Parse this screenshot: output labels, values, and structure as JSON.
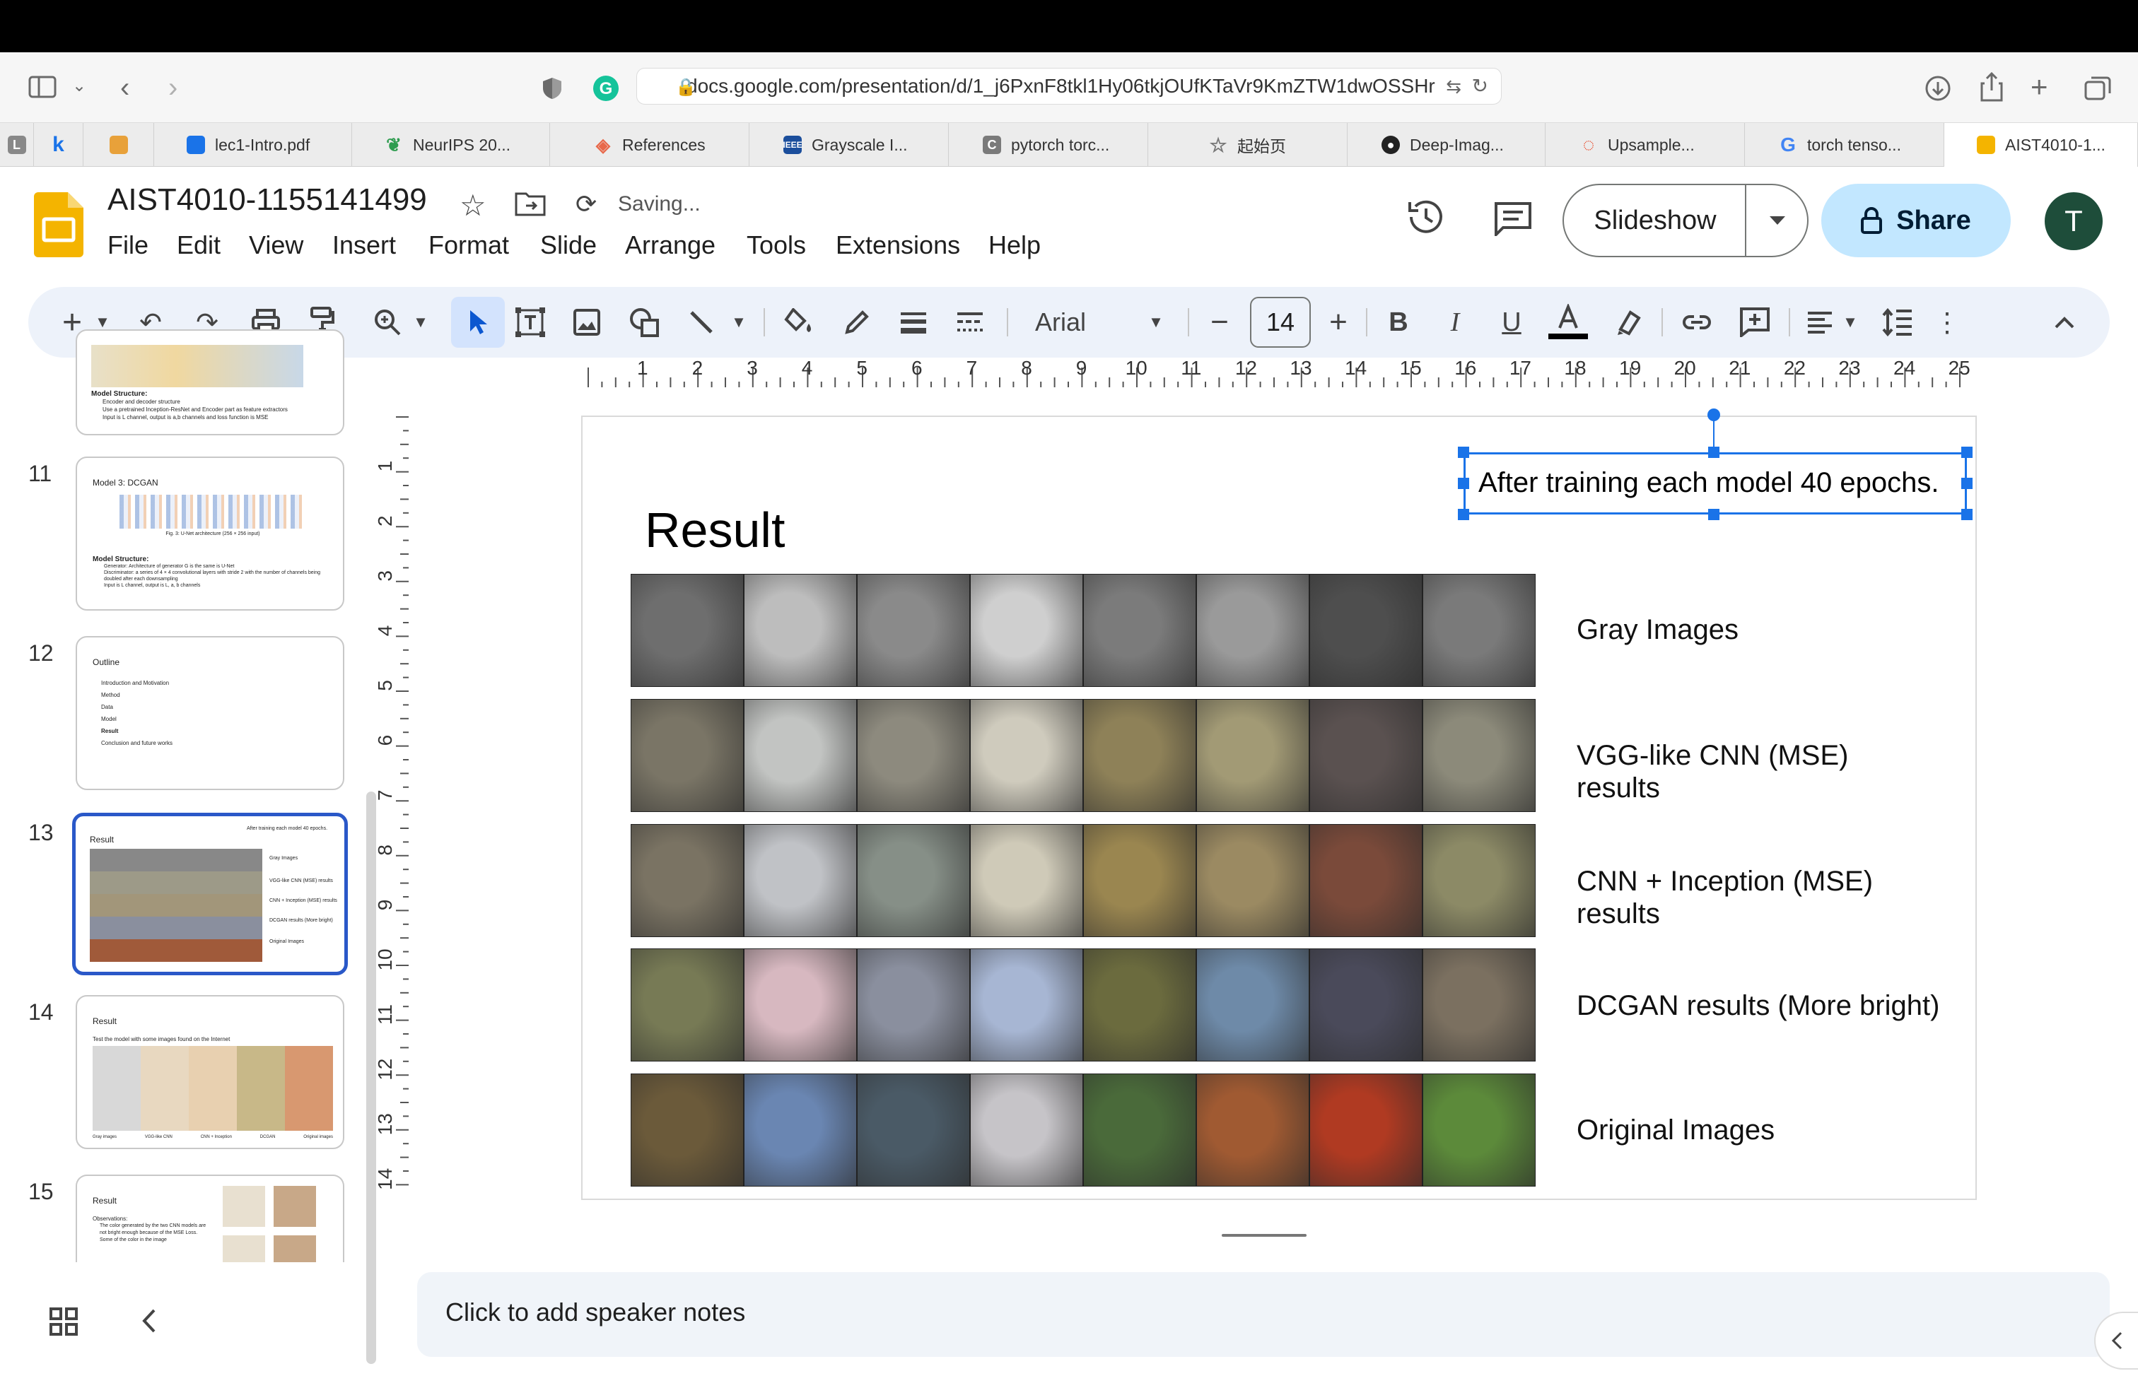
{
  "browser": {
    "url": "docs.google.com/presentation/d/1_j6PxnF8tkl1Hy06tkjOUfKTaVr9KmZTW1dwOSSHr",
    "tabs": [
      {
        "label": "L",
        "favicon_color": "#888888",
        "kind": "pinned"
      },
      {
        "label": "k",
        "favicon_color": "#1a73e8",
        "kind": "pinned"
      },
      {
        "label": "",
        "favicon_color": "#e8a13a",
        "kind": "pinned"
      },
      {
        "label": "lec1-Intro.pdf",
        "favicon_color": "#1a73e8"
      },
      {
        "label": "NeurIPS 20...",
        "favicon_color": "#2e9c4f"
      },
      {
        "label": "References",
        "favicon_color": "#e8684a"
      },
      {
        "label": "Grayscale I...",
        "favicon_color": "#1b4e9c"
      },
      {
        "label": "pytorch torc...",
        "favicon_color": "#7a7a7a"
      },
      {
        "label": "起始页",
        "favicon_color": "#777777"
      },
      {
        "label": "Deep-Imag...",
        "favicon_color": "#222222"
      },
      {
        "label": "Upsample...",
        "favicon_color": "#e84a2a"
      },
      {
        "label": "torch tenso...",
        "favicon_color": "#4285f4"
      },
      {
        "label": "AIST4010-1...",
        "favicon_color": "#f4b400",
        "active": true
      }
    ]
  },
  "docs": {
    "title": "AIST4010-1155141499",
    "status": "Saving...",
    "menu": [
      "File",
      "Edit",
      "View",
      "Insert",
      "Format",
      "Slide",
      "Arrange",
      "Tools",
      "Extensions",
      "Help"
    ],
    "slideshow_label": "Slideshow",
    "share_label": "Share",
    "avatar_letter": "T",
    "accent_color": "#1a73e8",
    "share_bg": "#c2e7ff"
  },
  "toolbar": {
    "font_name": "Arial",
    "font_size": "14"
  },
  "ruler": {
    "h_numbers": [
      "1",
      "2",
      "3",
      "4",
      "5",
      "6",
      "7",
      "8",
      "9",
      "10",
      "11",
      "12",
      "13",
      "14",
      "15",
      "16",
      "17",
      "18",
      "19",
      "20",
      "21",
      "22",
      "23",
      "24",
      "25"
    ],
    "v_numbers": [
      "1",
      "2",
      "3",
      "4",
      "5",
      "6",
      "7",
      "8",
      "9",
      "10",
      "11",
      "12",
      "13",
      "14"
    ]
  },
  "slides_panel": {
    "slides": [
      {
        "number": "",
        "title": "",
        "lines": [
          "Model Structure:",
          "Encoder and decoder structure",
          "Use a pretrained Inception-ResNet and Encoder part as feature extractors",
          "Input is L channel, output is a,b channels and loss function is MSE"
        ]
      },
      {
        "number": "11",
        "title": "Model 3: DCGAN",
        "lines": [
          "Fig. 3: U-Net architecture (256 × 256 input)",
          "Model Structure:",
          "Generator: Architecture of generator G is the same is U-Net",
          "Discriminator: a series of 4 × 4 convolutional layers with stride 2 with the number of channels being doubled after each downsampling",
          "Input is L channel, output is L, a, b channels"
        ]
      },
      {
        "number": "12",
        "title": "Outline",
        "lines": [
          "Introduction and Motivation",
          "Method",
          "Data",
          "Model",
          "Result",
          "Conclusion and future works"
        ]
      },
      {
        "number": "13",
        "title": "Result",
        "lines": [
          "After training each model 40 epochs.",
          "Gray Images",
          "VGG-like CNN (MSE) results",
          "CNN + Inception (MSE) results",
          "DCGAN results (More bright)",
          "Original Images"
        ]
      },
      {
        "number": "14",
        "title": "Result",
        "lines": [
          "Test the model with some images found on the Internet",
          "Gray images",
          "VGG-like CNN",
          "CNN + Inception",
          "DCGAN",
          "Original images"
        ]
      },
      {
        "number": "15",
        "title": "Result",
        "lines": [
          "Observations:",
          "The color generated by the two CNN models are not bright enough because of the MSE Loss.",
          "Some of the color in the image"
        ]
      }
    ]
  },
  "slide": {
    "title": "Result",
    "note_box": "After training each model 40 epochs.",
    "row_labels": [
      [
        "Gray Images"
      ],
      [
        "VGG-like CNN (MSE)",
        "results"
      ],
      [
        "CNN + Inception (MSE)",
        "results"
      ],
      [
        "DCGAN results (More bright)"
      ],
      [
        "Original Images"
      ]
    ],
    "row_tints": [
      [
        "#6e6e6e",
        "#bdbdbd",
        "#8a8a8a",
        "#cfcfcf",
        "#7b7b7b",
        "#9a9a9a",
        "#4e4e4e",
        "#7a7a7a"
      ],
      [
        "#7a7566",
        "#c2c4c2",
        "#8d8a7e",
        "#cfcbbd",
        "#8e8158",
        "#a29a75",
        "#5a5150",
        "#8c8a7a"
      ],
      [
        "#7a7363",
        "#c0c2c6",
        "#868f87",
        "#cfcab8",
        "#9a8650",
        "#9b8a62",
        "#7a4a3a",
        "#8c8a66"
      ],
      [
        "#777a55",
        "#d7b8c0",
        "#8a8f9e",
        "#a7b6d3",
        "#6b6b3e",
        "#6e8aa8",
        "#4a4a5a",
        "#7b7060"
      ],
      [
        "#6b5a3a",
        "#6a86b2",
        "#4a5a66",
        "#c6c4c8",
        "#4a6a3a",
        "#a05a32",
        "#b03a22",
        "#5c8a3a"
      ]
    ]
  },
  "notes": {
    "placeholder": "Click to add speaker notes"
  }
}
